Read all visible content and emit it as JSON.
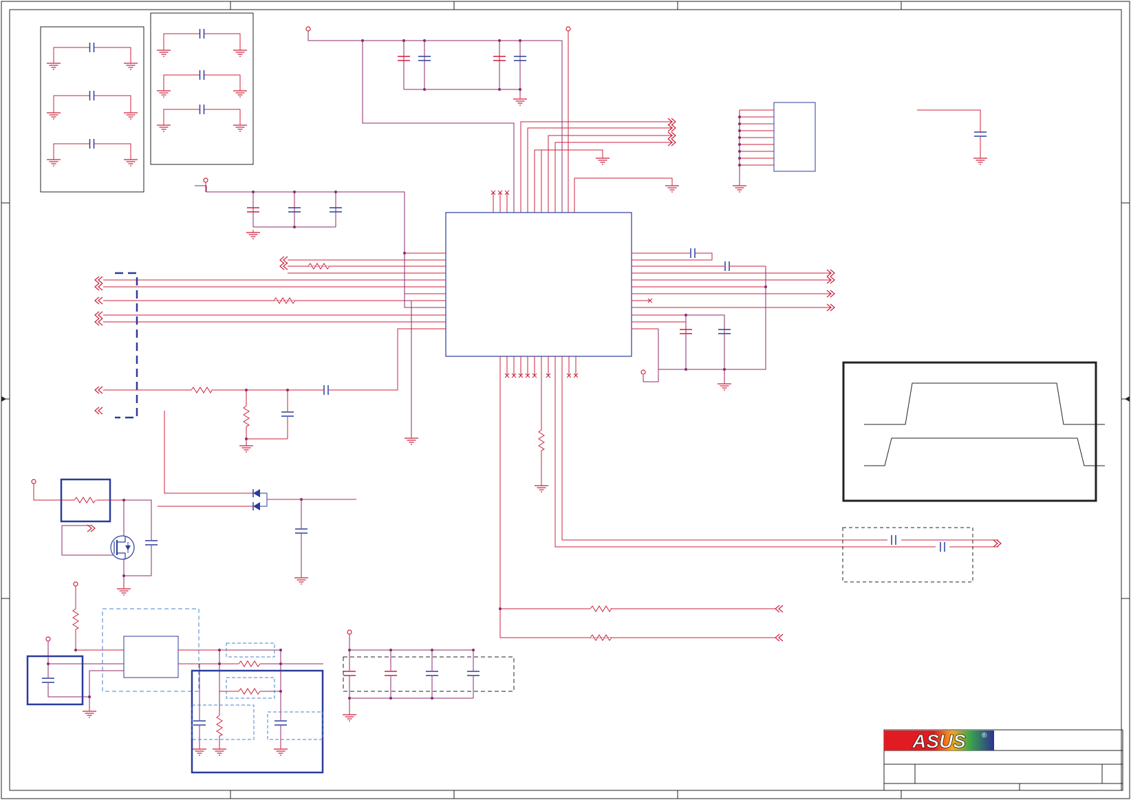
{
  "colors": {
    "wire": "#cc1f3a",
    "net": "#8b2a6b",
    "part": "#2a3b9a",
    "frame": "#222222",
    "dashed": "#4a7fd0",
    "logo_red": "#e11b22",
    "logo_blue": "#2e3192"
  },
  "title_block": {
    "logo_text": "ASUS",
    "registered_mark": "®"
  },
  "icons": {
    "logo": "asus-logo-icon",
    "power": "power-flag-icon",
    "ground": "ground-symbol-icon",
    "offpage": "offpage-connector-icon"
  }
}
